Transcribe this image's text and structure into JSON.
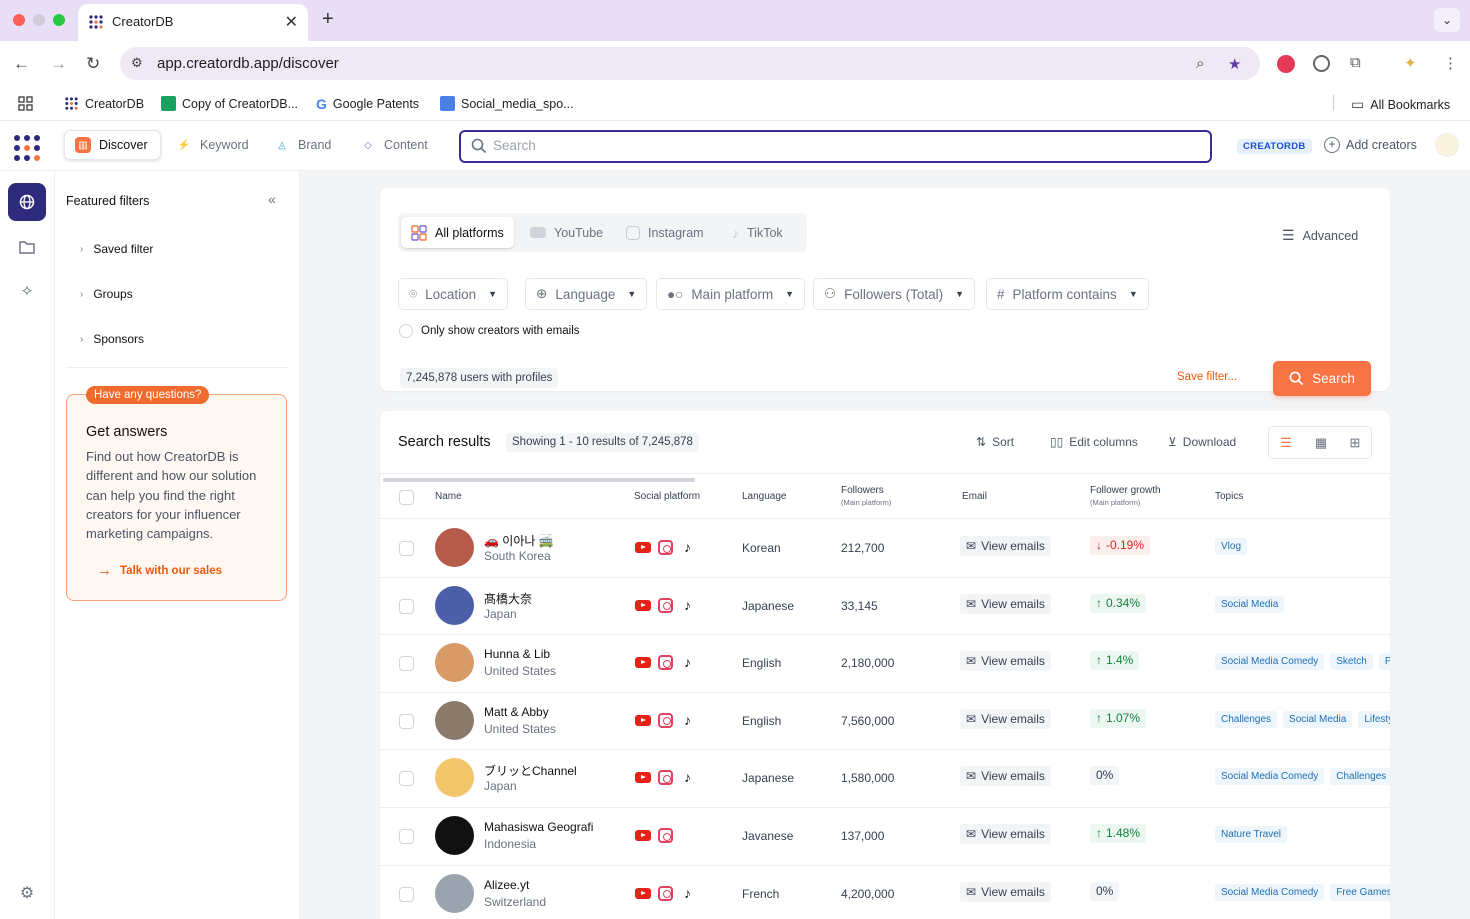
{
  "browser": {
    "tab_title": "CreatorDB",
    "tab_close": "✕",
    "new_tab": "+",
    "url": "app.creatordb.app/discover",
    "bookmarks": [
      "CreatorDB",
      "Copy of CreatorDB...",
      "Google Patents",
      "Social_media_spo..."
    ],
    "all_bookmarks": "All Bookmarks"
  },
  "appnav": {
    "tabs": [
      "Discover",
      "Keyword",
      "Brand",
      "Content"
    ],
    "search_placeholder": "Search",
    "badge": "CREATORDB",
    "add_creators": "Add creators"
  },
  "sidebar": {
    "title": "Featured filters",
    "items": [
      "Saved filter",
      "Groups",
      "Sponsors"
    ],
    "help": {
      "pill": "Have any questions?",
      "heading": "Get answers",
      "body": "Find out how CreatorDB is different and how our solution can help you find the right creators for your influencer marketing campaigns.",
      "cta": "Talk with our sales"
    }
  },
  "filters": {
    "platform_tabs": [
      "All platforms",
      "YouTube",
      "Instagram",
      "TikTok"
    ],
    "advanced": "Advanced",
    "dropdowns": [
      "Location",
      "Language",
      "Main platform",
      "Followers (Total)",
      "Platform contains"
    ],
    "emails_only": "Only show creators with emails",
    "user_count": "7,245,878 users with profiles",
    "save_filter": "Save filter...",
    "search_button": "Search"
  },
  "results": {
    "title": "Search results",
    "showing": "Showing 1 - 10 results of 7,245,878",
    "sort": "Sort",
    "edit_columns": "Edit columns",
    "download": "Download",
    "columns": {
      "name": "Name",
      "social": "Social platform",
      "language": "Language",
      "followers": "Followers",
      "followers_sub": "(Main platform)",
      "email": "Email",
      "growth": "Follower growth",
      "growth_sub": "(Main platform)",
      "topics": "Topics"
    },
    "rows": [
      {
        "name": "🚗 이아나 🚎",
        "country": "South Korea",
        "platforms": [
          "yt",
          "ig",
          "tt"
        ],
        "language": "Korean",
        "followers": "212,700",
        "email": "View emails",
        "growth": "-0.19%",
        "trend": "down",
        "topics": [
          "Vlog"
        ],
        "avatar_color": "#b65a4a"
      },
      {
        "name": "髙橋大奈",
        "country": "Japan",
        "platforms": [
          "yt",
          "ig",
          "tt"
        ],
        "language": "Japanese",
        "followers": "33,145",
        "email": "View emails",
        "growth": "0.34%",
        "trend": "up",
        "topics": [
          "Social Media"
        ],
        "avatar_color": "#4a5fa8"
      },
      {
        "name": "Hunna & Lib",
        "country": "United States",
        "platforms": [
          "yt",
          "ig",
          "tt"
        ],
        "language": "English",
        "followers": "2,180,000",
        "email": "View emails",
        "growth": "1.4%",
        "trend": "up",
        "topics": [
          "Social Media Comedy",
          "Sketch",
          "Pr"
        ],
        "avatar_color": "#d89a66"
      },
      {
        "name": "Matt & Abby",
        "country": "United States",
        "platforms": [
          "yt",
          "ig",
          "tt"
        ],
        "language": "English",
        "followers": "7,560,000",
        "email": "View emails",
        "growth": "1.07%",
        "trend": "up",
        "topics": [
          "Challenges",
          "Social Media",
          "Lifesty"
        ],
        "avatar_color": "#8a7a6a"
      },
      {
        "name": "ブリッとChannel",
        "country": "Japan",
        "platforms": [
          "yt",
          "ig",
          "tt"
        ],
        "language": "Japanese",
        "followers": "1,580,000",
        "email": "View emails",
        "growth": "0%",
        "trend": "flat",
        "topics": [
          "Social Media Comedy",
          "Challenges"
        ],
        "avatar_color": "#f3c66b"
      },
      {
        "name": "Mahasiswa Geografi",
        "country": "Indonesia",
        "platforms": [
          "yt",
          "ig"
        ],
        "language": "Javanese",
        "followers": "137,000",
        "email": "View emails",
        "growth": "1.48%",
        "trend": "up",
        "topics": [
          "Nature Travel"
        ],
        "avatar_color": "#111111"
      },
      {
        "name": "Alizee.yt",
        "country": "Switzerland",
        "platforms": [
          "yt",
          "ig",
          "tt"
        ],
        "language": "French",
        "followers": "4,200,000",
        "email": "View emails",
        "growth": "0%",
        "trend": "flat",
        "topics": [
          "Social Media Comedy",
          "Free Games"
        ],
        "avatar_color": "#9aa4ae"
      }
    ]
  },
  "colors": {
    "accent": "#f97444",
    "nav_active": "#2e2a7c",
    "search_border": "#3b2a8f"
  }
}
